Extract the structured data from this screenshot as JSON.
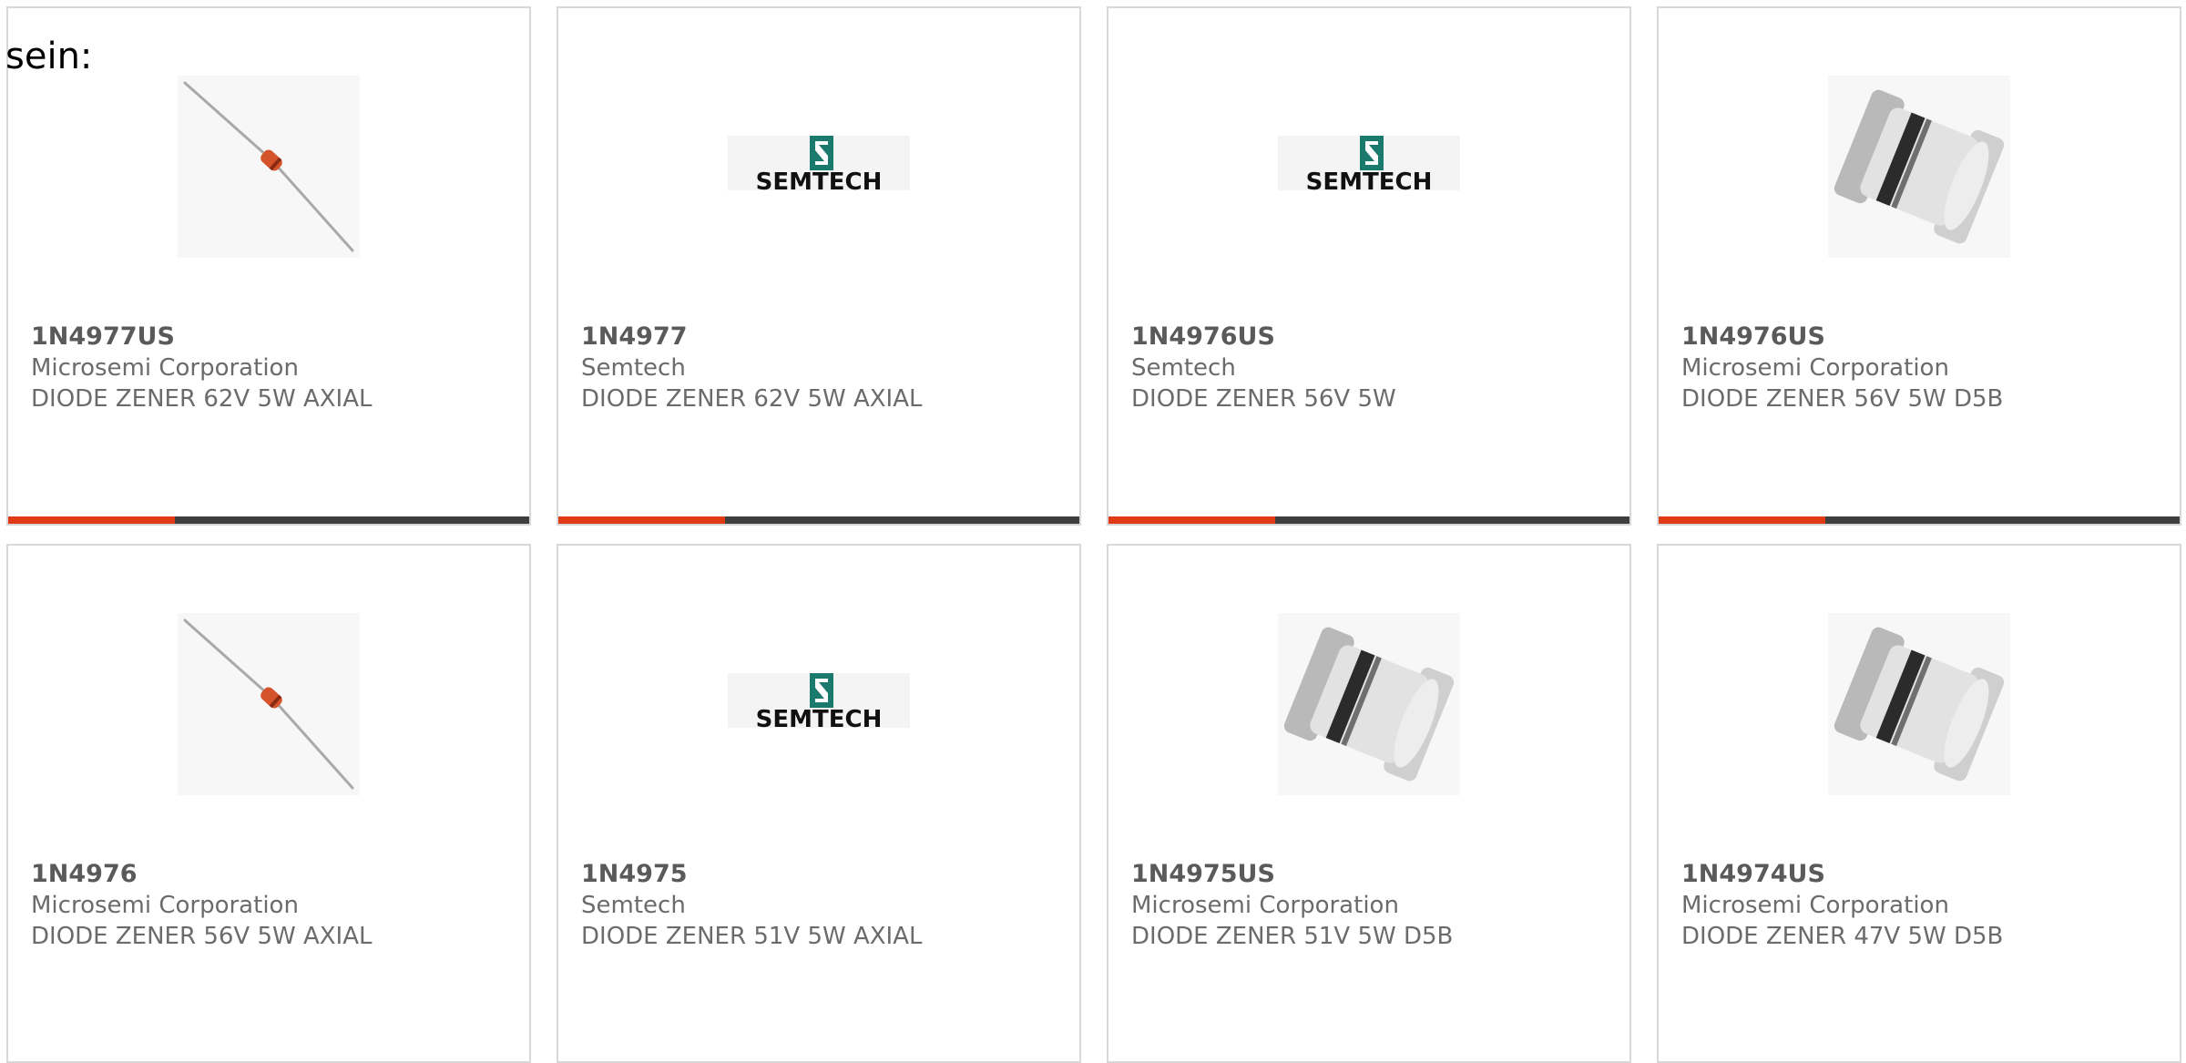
{
  "lead_text": "sein:",
  "colors": {
    "accent": "#e03a14",
    "bar": "#3f3f3f",
    "card_border": "#d8d8d8",
    "title_text": "#5a5a5a",
    "body_text": "#6b6b6b",
    "semtech_teal": "#1a7a6e"
  },
  "products": [
    {
      "part_number": "1N4977US",
      "manufacturer": "Microsemi Corporation",
      "description": "DIODE ZENER 62V 5W AXIAL",
      "image": "axial-diode-image",
      "show_bar": true
    },
    {
      "part_number": "1N4977",
      "manufacturer": "Semtech",
      "description": "DIODE ZENER 62V 5W AXIAL",
      "image": "semtech-logo",
      "logo_text": "SEMTECH",
      "show_bar": true
    },
    {
      "part_number": "1N4976US",
      "manufacturer": "Semtech",
      "description": "DIODE ZENER 56V 5W",
      "image": "semtech-logo",
      "logo_text": "SEMTECH",
      "show_bar": true
    },
    {
      "part_number": "1N4976US",
      "manufacturer": "Microsemi Corporation",
      "description": "DIODE ZENER 56V 5W D5B",
      "image": "d5b-package-image",
      "show_bar": true
    },
    {
      "part_number": "1N4976",
      "manufacturer": "Microsemi Corporation",
      "description": "DIODE ZENER 56V 5W AXIAL",
      "image": "axial-diode-image",
      "show_bar": false
    },
    {
      "part_number": "1N4975",
      "manufacturer": "Semtech",
      "description": "DIODE ZENER 51V 5W AXIAL",
      "image": "semtech-logo",
      "logo_text": "SEMTECH",
      "show_bar": false
    },
    {
      "part_number": "1N4975US",
      "manufacturer": "Microsemi Corporation",
      "description": "DIODE ZENER 51V 5W D5B",
      "image": "d5b-package-image",
      "show_bar": false
    },
    {
      "part_number": "1N4974US",
      "manufacturer": "Microsemi Corporation",
      "description": "DIODE ZENER 47V 5W D5B",
      "image": "d5b-package-image",
      "show_bar": false
    }
  ]
}
